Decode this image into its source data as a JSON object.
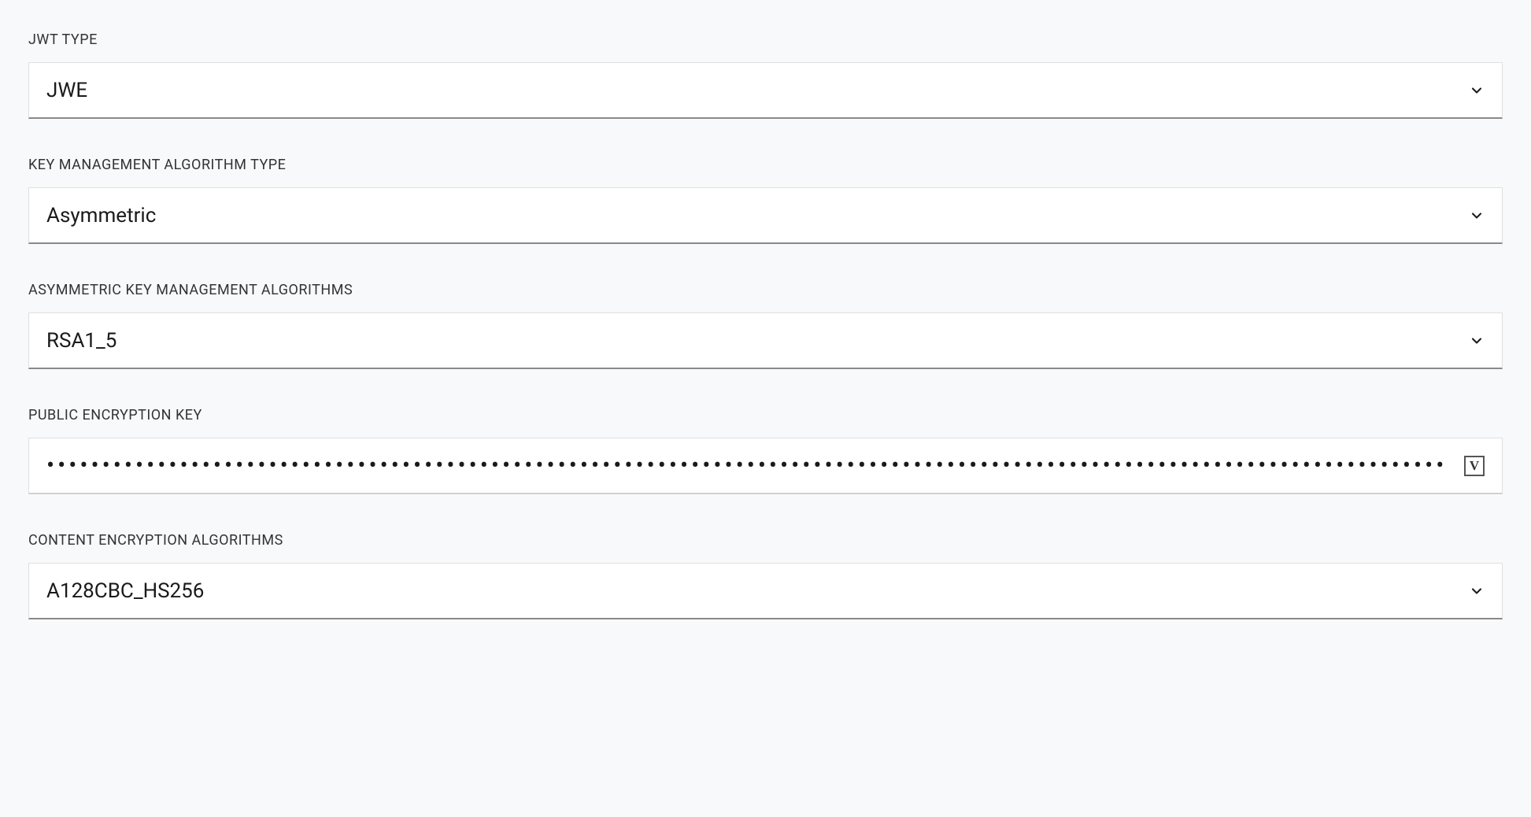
{
  "form": {
    "fields": [
      {
        "label": "JWT TYPE",
        "value": "JWE",
        "type": "select"
      },
      {
        "label": "KEY MANAGEMENT ALGORITHM TYPE",
        "value": "Asymmetric",
        "type": "select"
      },
      {
        "label": "ASYMMETRIC KEY MANAGEMENT ALGORITHMS",
        "value": "RSA1_5",
        "type": "select"
      },
      {
        "label": "PUBLIC ENCRYPTION KEY",
        "value": "••••••••••••••••••••••••••••••••••••••••••••••••••••••••••••••••••••••••••••••••••••••••••••••••••••••••••••••••••••••••••••••",
        "type": "masked"
      },
      {
        "label": "CONTENT ENCRYPTION ALGORITHMS",
        "value": "A128CBC_HS256",
        "type": "select"
      }
    ]
  },
  "icons": {
    "vault": "V"
  }
}
